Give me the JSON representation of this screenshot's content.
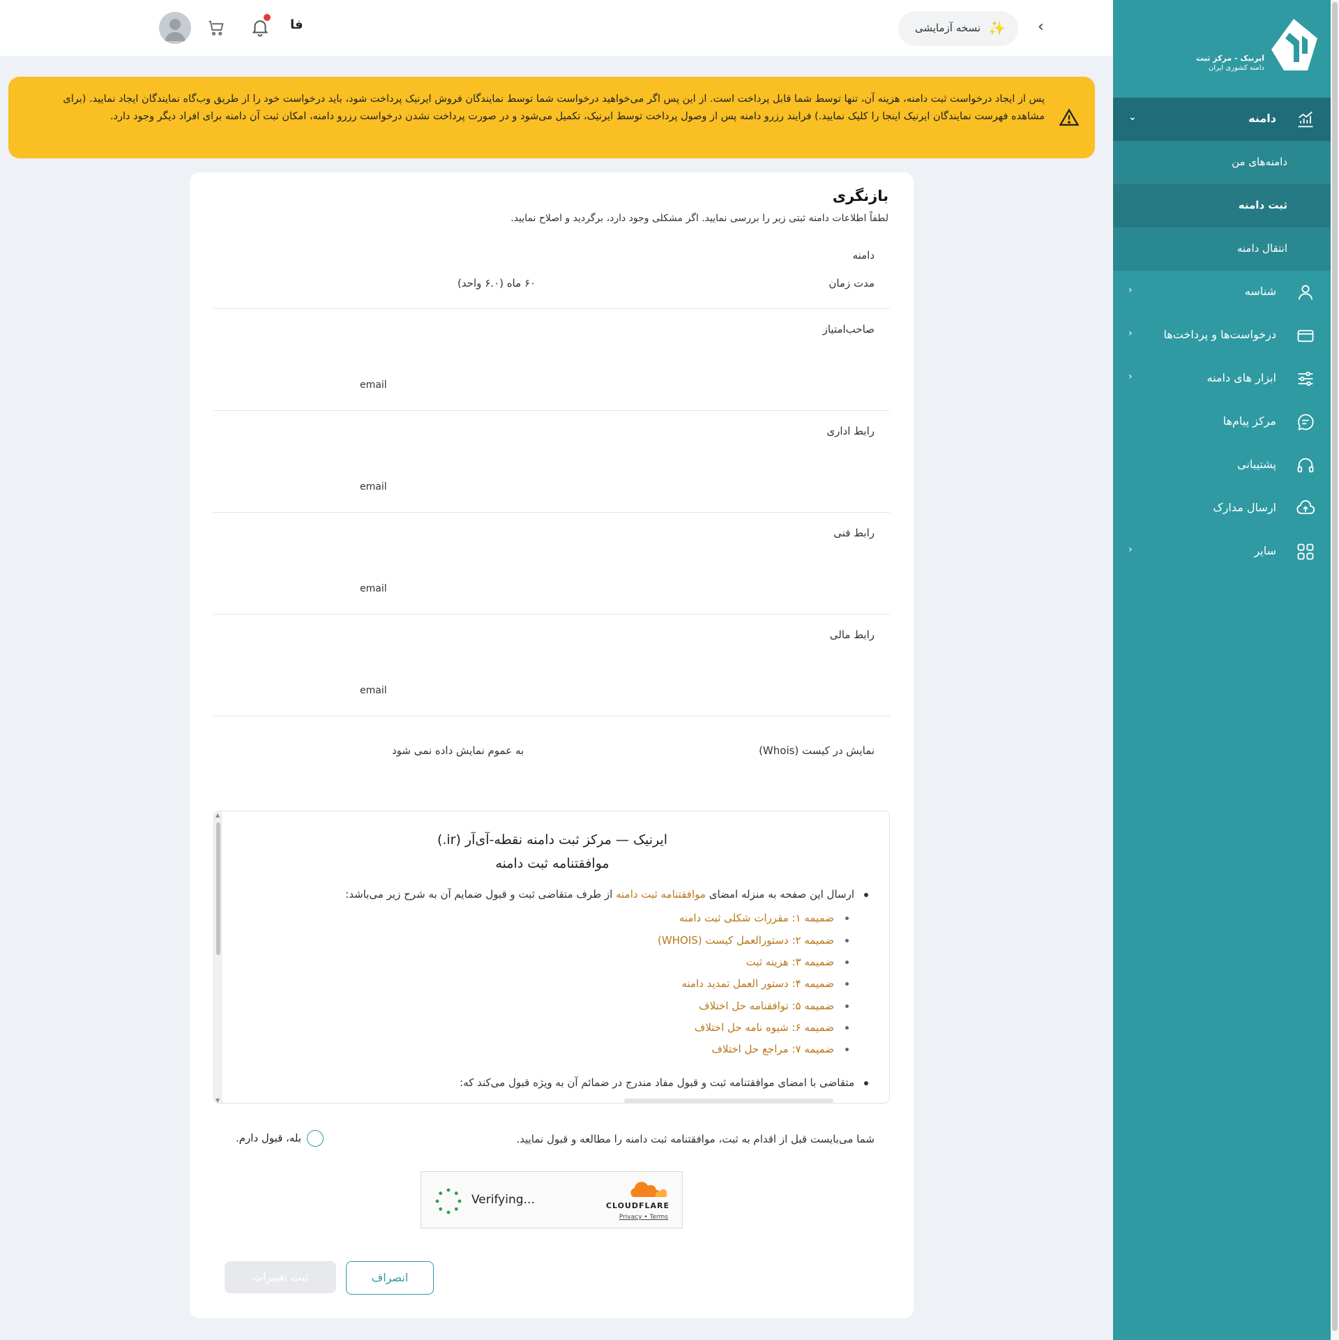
{
  "topbar": {
    "trial_label": "نسخه آزمایشی",
    "lang": "فا"
  },
  "alert": {
    "text": "پس از ایجاد درخواست ثبت دامنه، هزینه آن، تنها توسط شما قابل پرداخت است. از این پس اگر می‌خواهید درخواست شما توسط نمایندگان فروش ایرنیک پرداخت شود، باید درخواست خود را از طریق وب‌گاه نمایندگان ایجاد نمایید. (برای مشاهده فهرست نمایندگان ایرنیک اینجا را کلیک نمایید.) فرایند رزرو دامنه پس از وصول پرداخت توسط ایرنیک، تکمیل می‌شود و در صورت پرداخت نشدن درخواست رزرو دامنه، امکان ثبت آن دامنه برای افراد دیگر وجود دارد."
  },
  "sidebar": {
    "logo_line1": "ایرنیک - مرکز ثبت",
    "logo_line2": "دامنه کشوری ایران",
    "domain_section": "دامنه",
    "sub_items": [
      "دامنه‌های من",
      "ثبت دامنه",
      "انتقال دامنه"
    ],
    "items": [
      "شناسه",
      "درخواست‌ها و پرداخت‌ها",
      "ابزار های دامنه",
      "مرکز پیام‌ها",
      "پشتیبانی",
      "ارسال مدارک",
      "سایر"
    ]
  },
  "review": {
    "title": "بازنگری",
    "subtitle": "لطفاً اطلاعات دامنه ثبتی زیر را بررسی نمایید. اگر مشکلی وجود دارد، برگردید و اصلاح نمایید.",
    "domain_label": "دامنه",
    "duration_label": "مدت زمان",
    "duration_value": "۶۰ ماه (۶.۰ واحد)",
    "owner_label": "صاحب‌امتیاز",
    "admin_label": "رابط اداری",
    "tech_label": "رابط فنی",
    "billing_label": "رابط مالی",
    "email_label": "email",
    "whois_label": "نمایش در کیست (Whois)",
    "whois_value": "به عموم نمایش داده نمی شود"
  },
  "agreement": {
    "heading1": "ایرنیک — مرکز ثبت دامنه نقطه-آی‌آر (ir.)",
    "heading2": "موافقتنامه ثبت دامنه",
    "intro_before": "ارسال این صفحه به منزله امضای",
    "intro_link": "موافقتنامه ثبت دامنه",
    "intro_after": "از طرف متقاضی ثبت و قبول ضمایم آن به شرح زیر می‌باشد:",
    "attachments": [
      "ضمیمه ۱: مقررات شکلی ثبت دامنه",
      "ضمیمه ۲: دستورالعمل کیست (WHOIS)",
      "ضمیمه ۳: هزینه ثبت",
      "ضمیمه ۴: دستور العمل تمدید دامنه",
      "ضمیمه ۵: توافقنامه حل اختلاف",
      "ضمیمه ۶: شیوه نامه حل اختلاف",
      "ضمیمه ۷: مراجع حل اختلاف"
    ],
    "clause2": "متقاضی با امضای موافقتنامه ثبت و قبول مفاد مندرج در ضمائم آن به ویژه قبول می‌کند که:"
  },
  "consent": {
    "must_text": "شما می‌بایست قبل از اقدام به ثبت، موافقتنامه ثبت دامنه را مطالعه و قبول نمایید.",
    "accept_label": "بله، قبول دارم."
  },
  "captcha": {
    "status": "Verifying...",
    "brand": "CLOUDFLARE",
    "privacy": "Privacy",
    "sep": "•",
    "terms": "Terms"
  },
  "actions": {
    "cancel": "انصراف",
    "submit": "ثبت تغییرات"
  },
  "colors": {
    "brand": "#2f9aa2",
    "sidebar_dark": "#1e6d78",
    "alert": "#f9bf23",
    "link": "#b8781b"
  }
}
